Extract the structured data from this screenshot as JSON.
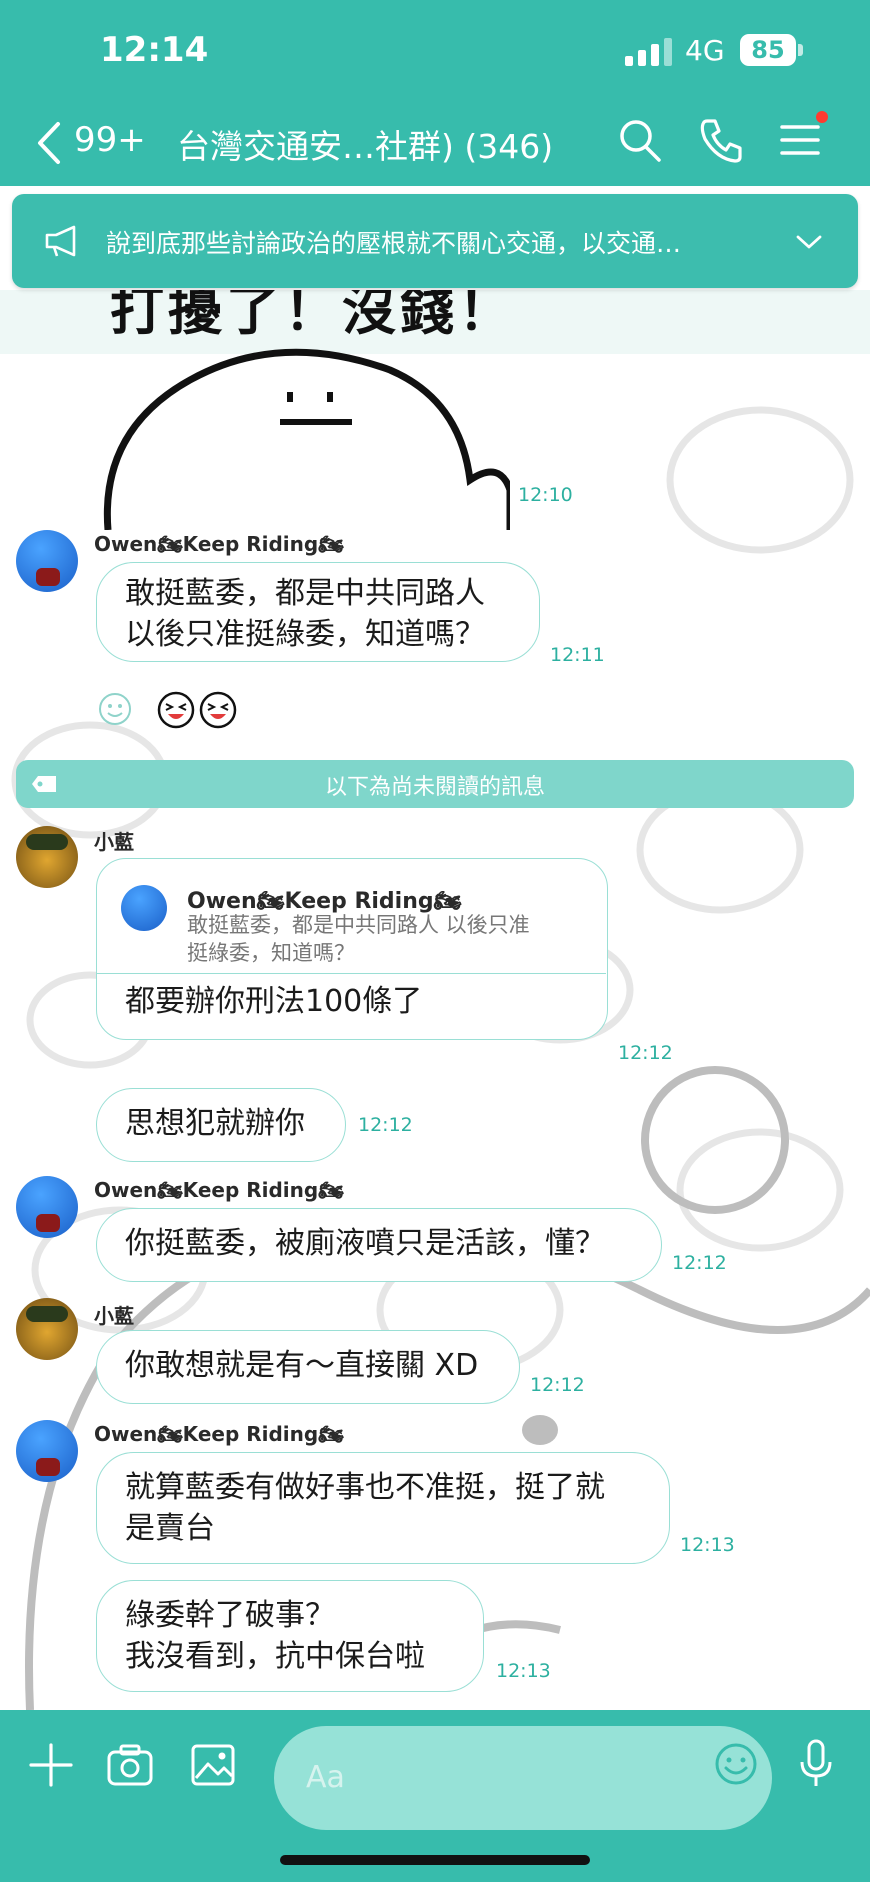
{
  "status": {
    "time": "12:14",
    "network": "4G",
    "battery": "85"
  },
  "header": {
    "back_count": "99+",
    "title": "台灣交通安…社群) (346)"
  },
  "announcement": {
    "text": "說到底那些討論政治的壓根就不關心交通，以交通…"
  },
  "sticker": {
    "caption": "打擾了！沒錢！",
    "time": "12:10"
  },
  "unread_divider": "以下為尚未閱讀的訊息",
  "messages": [
    {
      "sender": "Owen🏍Keep Riding🏍",
      "text": "敢挺藍委，都是中共同路人\n以後只准挺綠委，知道嗎？",
      "time": "12:11"
    },
    {
      "sender": "小藍",
      "quote_sender": "Owen🏍Keep Riding🏍",
      "quote_text": "敢挺藍委，都是中共同路人 以後只准\n挺綠委，知道嗎？",
      "text": "都要辦你刑法100條了",
      "time": "12:12"
    },
    {
      "sender": "",
      "text": "思想犯就辦你",
      "time": "12:12"
    },
    {
      "sender": "Owen🏍Keep Riding🏍",
      "text": "你挺藍委，被廁液噴只是活該，懂？",
      "time": "12:12"
    },
    {
      "sender": "小藍",
      "text": "你敢想就是有～直接關 XD",
      "time": "12:12"
    },
    {
      "sender": "Owen🏍Keep Riding🏍",
      "text": "就算藍委有做好事也不准挺，挺了就\n是賣台",
      "time": "12:13"
    },
    {
      "sender": "",
      "text": "綠委幹了破事？\n 我沒看到，抗中保台啦",
      "time": "12:13"
    }
  ],
  "input": {
    "placeholder": "Aa"
  },
  "colors": {
    "accent": "#37bcac",
    "bubble_border": "#9adfd5",
    "time_text": "#2db0a0"
  }
}
